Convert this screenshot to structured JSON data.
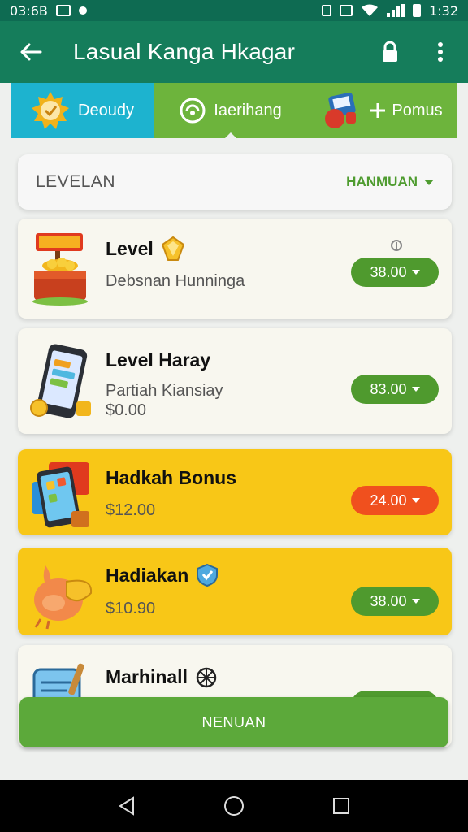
{
  "status_bar": {
    "time_left": "03:6B",
    "time_right": "1:32"
  },
  "app_bar": {
    "title": "Lasual Kanga Hkagar"
  },
  "tabs": [
    {
      "label": "Deoudy",
      "icon": "sun-badge-icon"
    },
    {
      "label": "Iaerihang",
      "icon": "wifi-circle-icon"
    },
    {
      "label": "Pomus",
      "icon": "plus-icon"
    }
  ],
  "filter": {
    "label": "LEVELAN",
    "selected": "HANMUAN"
  },
  "cards": [
    {
      "title": "Level",
      "subtitle": "Debsnan Hunninga",
      "button": "38.00",
      "icon": "market-stall-icon",
      "badge": "gem-icon",
      "corner": "coin-icon"
    },
    {
      "title": "Level Haray",
      "subtitle": "Partiah Kiansiay",
      "price": "$0.00",
      "button": "83.00",
      "icon": "phone-icon"
    },
    {
      "title": "Hadkah Bonus",
      "price": "$12.00",
      "button": "24.00",
      "icon": "gift-phone-icon"
    },
    {
      "title": "Hadiakan",
      "price": "$10.90",
      "button": "38.00",
      "icon": "chicken-icon",
      "badge": "shield-icon"
    },
    {
      "title": "Marhinall",
      "icon": "scroll-icon",
      "badge": "wheel-icon"
    }
  ],
  "cta": {
    "label": "NENUAN"
  },
  "colors": {
    "primary": "#157d5b",
    "green": "#5ca93a",
    "yellow": "#f8c717",
    "cyan": "#1db3cf",
    "red": "#f0501e"
  }
}
